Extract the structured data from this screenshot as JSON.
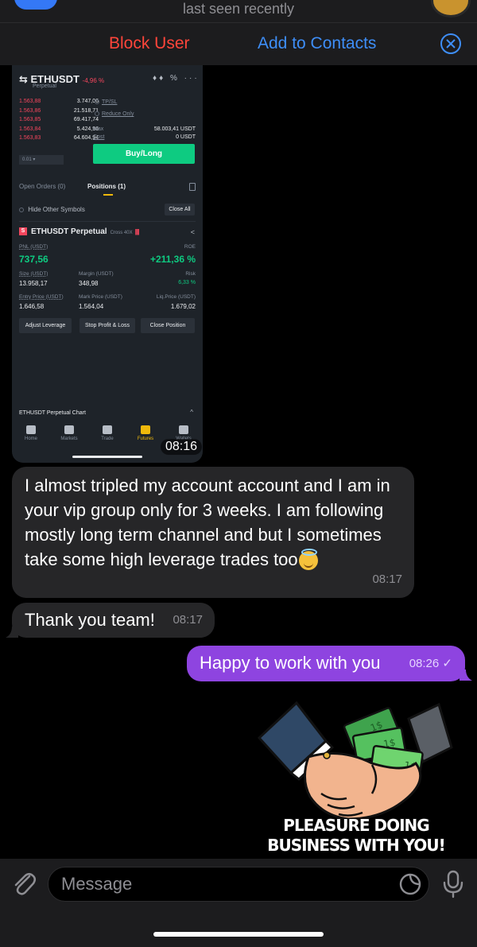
{
  "header": {
    "subtitle": "last seen recently"
  },
  "actions": {
    "block_label": "Block User",
    "add_label": "Add to Contacts"
  },
  "screenshot": {
    "pair": "ETHUSDT",
    "change": "-4,96 %",
    "contract": "Perpetual",
    "orderbook": [
      {
        "price": "1.563,88",
        "qty": "3.747,06"
      },
      {
        "price": "1.563,86",
        "qty": "21.518,71"
      },
      {
        "price": "1.563,85",
        "qty": "69.417,74"
      },
      {
        "price": "1.563,84",
        "qty": "5.424,96"
      },
      {
        "price": "1.563,83",
        "qty": "64.604,94"
      }
    ],
    "tpsl": "TP/SL",
    "reduce_only": "Reduce Only",
    "max_label": "Max",
    "cost_label": "Cost",
    "max_value": "58.003,41 USDT",
    "cost_value": "0 USDT",
    "qty_value": "0.01",
    "buy_label": "Buy/Long",
    "tab_orders": "Open Orders (0)",
    "tab_positions": "Positions (1)",
    "hide_other": "Hide Other Symbols",
    "close_all": "Close All",
    "position_name": "ETHUSDT Perpetual",
    "position_side": "S",
    "position_mode": "Cross 40X",
    "pnl_label": "PNL (USDT)",
    "pnl_value": "737,56",
    "roe_label": "ROE",
    "roe_value": "+211,36 %",
    "size_label": "Size (USDT)",
    "size_value": "13.958,17",
    "margin_label": "Margin (USDT)",
    "margin_value": "348,98",
    "risk_label": "Risk",
    "risk_value": "6,33 %",
    "entry_label": "Entry Price (USDT)",
    "entry_value": "1.646,58",
    "mark_label": "Mark Price (USDT)",
    "mark_value": "1.564,04",
    "liq_label": "Liq.Price (USDT)",
    "liq_value": "1.679,02",
    "btn_leverage": "Adjust Leverage",
    "btn_tpsl": "Stop Profit & Loss",
    "btn_close": "Close Position",
    "chart_label": "ETHUSDT Perpetual  Chart",
    "nav": [
      "Home",
      "Markets",
      "Trade",
      "Futures",
      "Wallets"
    ],
    "time": "08:16"
  },
  "messages": [
    {
      "text": "I almost tripled my account account and I am in your vip group only for 3 weeks. I am following mostly long term channel and but I sometimes take some high leverage trades too",
      "time": "08:17"
    },
    {
      "text": "Thank you team!",
      "time": "08:17"
    },
    {
      "text": "Happy to work with you",
      "time": "08:26"
    }
  ],
  "sticker": {
    "line1": "PLEASURE DOING",
    "line2": "BUSINESS WITH YOU!"
  },
  "composer": {
    "placeholder": "Message"
  },
  "colors": {
    "outgoing_bubble": "#8e44e0",
    "incoming_bubble": "#262628",
    "block_red": "#ff453a",
    "link_blue": "#3e8ef7",
    "buy_green": "#0ecb81",
    "sell_red": "#f6465d"
  }
}
